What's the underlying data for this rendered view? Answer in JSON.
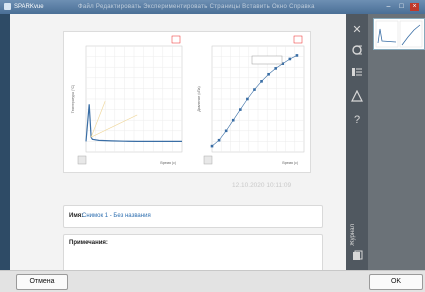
{
  "window": {
    "title": "SPARKvue",
    "menu_text": "Файл   Редактировать   Экспериментировать   Страницы   Вставить   Окно   Справка",
    "min_symbol": "–",
    "max_symbol": "□",
    "close_symbol": "×"
  },
  "graphs": {
    "left_chart": {
      "type": "line",
      "ylabel": "Температура (°C)",
      "xlabel": "Время (с)",
      "x_ticks": [
        "0",
        "10",
        "20",
        "30",
        "40",
        "50",
        "60",
        "70",
        "80",
        "90",
        "100",
        "110",
        "120",
        "130",
        "140",
        "150"
      ],
      "y_ticks": [
        "0",
        "10",
        "20",
        "30",
        "40",
        "50",
        "60",
        "70",
        "80",
        "90",
        "100"
      ]
    },
    "right_chart": {
      "type": "scatter",
      "ylabel": "Давление (кПа)",
      "xlabel": "Время (с)",
      "tooltip": "—"
    }
  },
  "chart_data": [
    {
      "type": "line",
      "x": [
        0,
        5,
        8,
        10,
        20,
        40,
        60,
        80,
        100,
        120,
        140,
        150
      ],
      "y": [
        10,
        45,
        14,
        12,
        11,
        10.5,
        10.2,
        10,
        10,
        10,
        10,
        10
      ],
      "xlim": [
        0,
        150
      ],
      "ylim": [
        0,
        100
      ],
      "grid": true
    },
    {
      "type": "scatter",
      "x": [
        0,
        10,
        20,
        30,
        40,
        50,
        60,
        70,
        80,
        90,
        100,
        110,
        120
      ],
      "y": [
        5,
        10,
        18,
        27,
        36,
        45,
        53,
        60,
        66,
        71,
        75,
        79,
        82
      ],
      "xlim": [
        0,
        130
      ],
      "ylim": [
        0,
        90
      ],
      "grid": true
    }
  ],
  "watermark": "12.10.2020 10:11:09",
  "name_field": {
    "label": "Имя:",
    "value": "Снимок 1 - Без названия"
  },
  "notes_field": {
    "label": "Примечания:"
  },
  "right_panel": {
    "icons": [
      "close-icon",
      "align-icon",
      "list-icon",
      "triangle-icon",
      "help-icon"
    ],
    "close_glyph": "✕",
    "help_glyph": "?",
    "journal_label": "Журнал"
  },
  "bottom": {
    "cancel_label": "Отмена",
    "ok_label": "OK"
  }
}
